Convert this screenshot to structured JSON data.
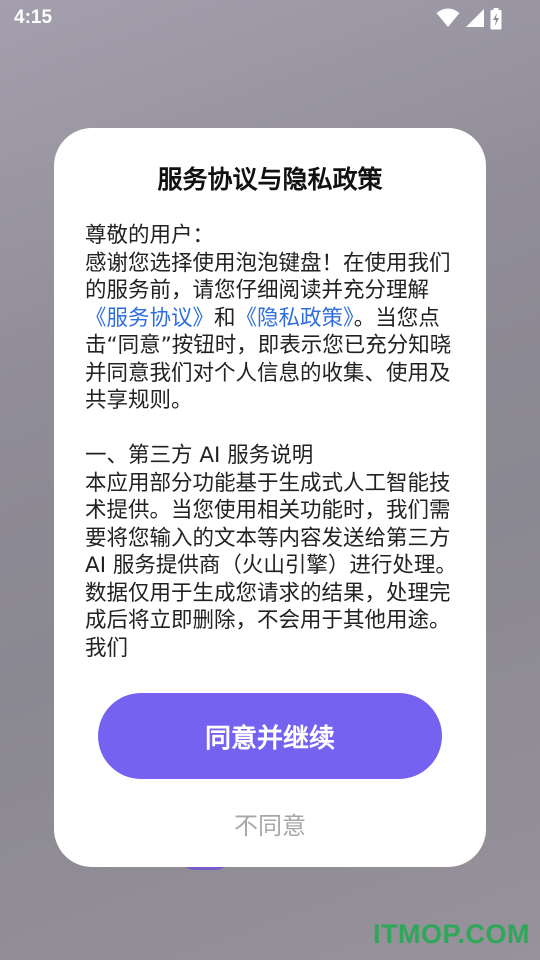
{
  "status_bar": {
    "time": "4:15",
    "icons": [
      "wifi-icon",
      "cellular-signal-icon",
      "battery-charging-icon"
    ]
  },
  "dialog": {
    "title": "服务协议与隐私政策",
    "greeting": "尊敬的用户：",
    "intro_before": "感谢您选择使用泡泡键盘！在使用我们的服务前，请您仔细阅读并充分理解",
    "service_agreement_link": "《服务协议》",
    "and_text": "和",
    "privacy_policy_link": "《隐私政策》",
    "intro_after": "。当您点击“同意”按钮时，即表示您已充分知晓并同意我们对个人信息的收集、使用及共享规则。",
    "section1_heading": "一、第三方 AI 服务说明",
    "section1_text": "本应用部分功能基于生成式人工智能技术提供。当您使用相关功能时，我们需要将您输入的文本等内容发送给第三方 AI 服务提供商（火山引擎）进行处理。数据仅用于生成您请求的结果，处理完成后将立即删除，不会用于其他用途。我们",
    "agree_button": "同意并继续",
    "disagree_button": "不同意"
  },
  "watermark": "ITMOP.COM",
  "colors": {
    "primary_button": "#7662f1",
    "link": "#2f6ee0",
    "watermark": "#2ea858"
  }
}
